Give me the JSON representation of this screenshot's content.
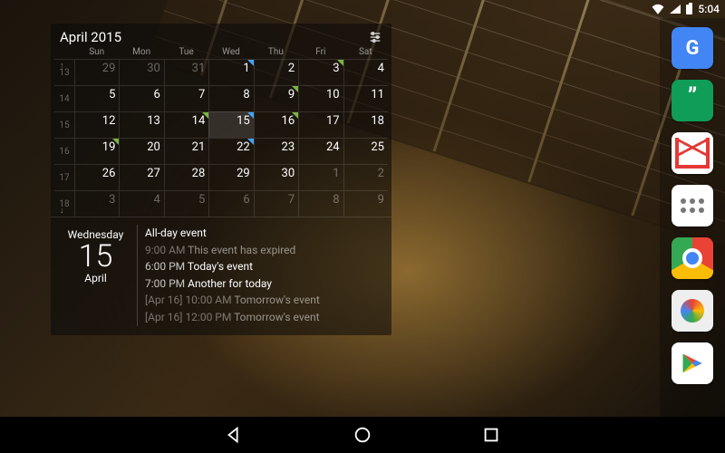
{
  "status": {
    "time": "5:04"
  },
  "dock": [
    {
      "name": "google"
    },
    {
      "name": "hangouts"
    },
    {
      "name": "gmail"
    },
    {
      "name": "app-drawer"
    },
    {
      "name": "chrome"
    },
    {
      "name": "camera"
    },
    {
      "name": "play-store"
    }
  ],
  "calendar": {
    "title": "April 2015",
    "dow": [
      "Sun",
      "Mon",
      "Tue",
      "Wed",
      "Thu",
      "Fri",
      "Sat"
    ],
    "weeks": [
      {
        "wk": "13",
        "days": [
          {
            "n": "29",
            "other": true
          },
          {
            "n": "30",
            "other": true
          },
          {
            "n": "31",
            "other": true
          },
          {
            "n": "1",
            "marks": [
              "blue"
            ]
          },
          {
            "n": "2"
          },
          {
            "n": "3",
            "marks": [
              "green"
            ]
          },
          {
            "n": "4"
          }
        ]
      },
      {
        "wk": "14",
        "days": [
          {
            "n": "5"
          },
          {
            "n": "6"
          },
          {
            "n": "7"
          },
          {
            "n": "8"
          },
          {
            "n": "9",
            "marks": [
              "green"
            ]
          },
          {
            "n": "10"
          },
          {
            "n": "11"
          }
        ]
      },
      {
        "wk": "15",
        "days": [
          {
            "n": "12"
          },
          {
            "n": "13"
          },
          {
            "n": "14",
            "marks": [
              "green"
            ]
          },
          {
            "n": "15",
            "today": true,
            "marks": [
              "blue"
            ]
          },
          {
            "n": "16",
            "marks": [
              "green"
            ]
          },
          {
            "n": "17"
          },
          {
            "n": "18"
          }
        ]
      },
      {
        "wk": "16",
        "days": [
          {
            "n": "19",
            "marks": [
              "green"
            ]
          },
          {
            "n": "20"
          },
          {
            "n": "21"
          },
          {
            "n": "22",
            "marks": [
              "blue"
            ]
          },
          {
            "n": "23"
          },
          {
            "n": "24"
          },
          {
            "n": "25"
          }
        ]
      },
      {
        "wk": "17",
        "days": [
          {
            "n": "26"
          },
          {
            "n": "27"
          },
          {
            "n": "28"
          },
          {
            "n": "29"
          },
          {
            "n": "30"
          },
          {
            "n": "1",
            "other": true
          },
          {
            "n": "2",
            "other": true
          }
        ]
      },
      {
        "wk": "18",
        "days": [
          {
            "n": "3",
            "other": true
          },
          {
            "n": "4",
            "other": true
          },
          {
            "n": "5",
            "other": true
          },
          {
            "n": "6",
            "other": true
          },
          {
            "n": "7",
            "other": true
          },
          {
            "n": "8",
            "other": true
          },
          {
            "n": "9",
            "other": true
          }
        ]
      }
    ],
    "agenda": {
      "dow": "Wednesday",
      "daynum": "15",
      "month": "April",
      "events": [
        {
          "text": "All-day event",
          "dim": false
        },
        {
          "time": "9:00 AM",
          "text": "This event has expired",
          "dim": true
        },
        {
          "time": "6:00 PM",
          "text": "Today's event",
          "dim": false
        },
        {
          "time": "7:00 PM",
          "text": "Another for today",
          "dim": false
        },
        {
          "prefix": "[Apr 16]",
          "time": "10:00 AM",
          "text": "Tomorrow's event",
          "dim": true
        },
        {
          "prefix": "[Apr 16]",
          "time": "12:00 PM",
          "text": "Tomorrow's event",
          "dim": true
        }
      ]
    }
  }
}
